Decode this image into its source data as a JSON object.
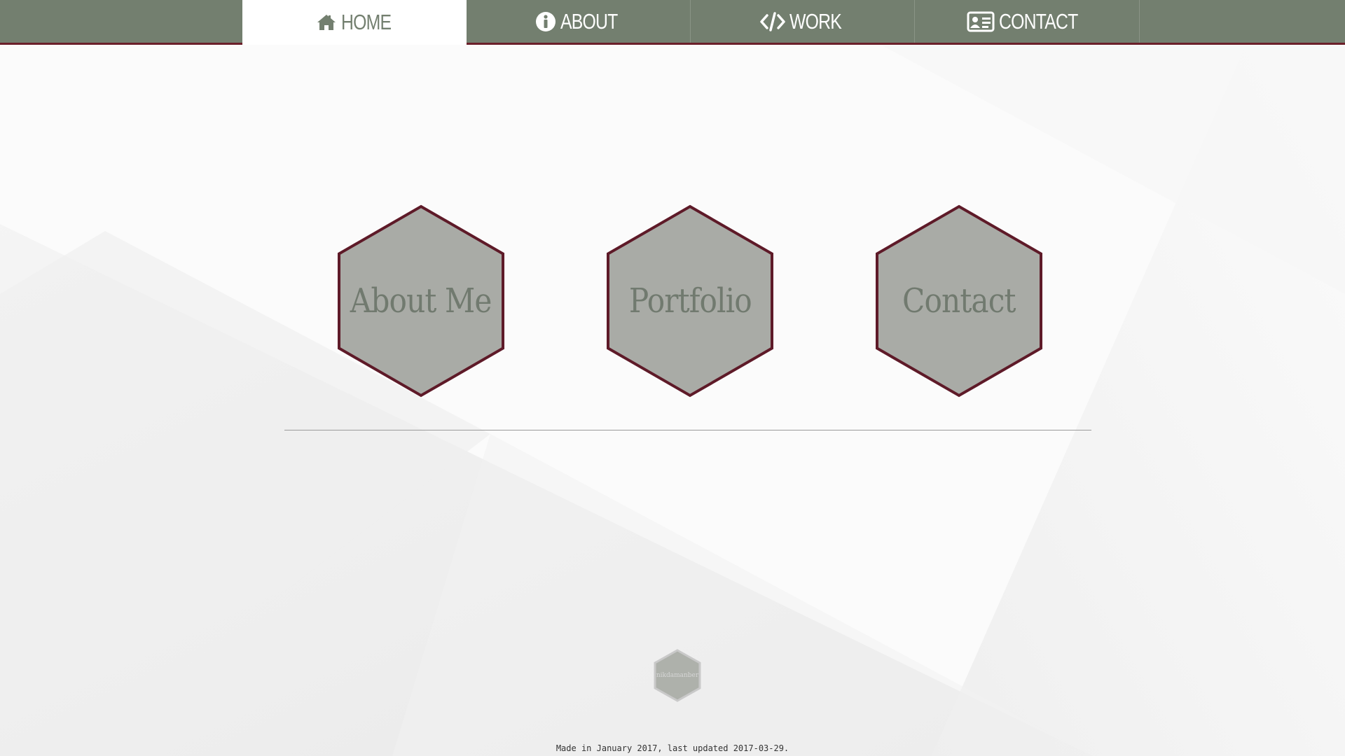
{
  "nav": {
    "items": [
      {
        "label": "HOME",
        "icon": "home-icon",
        "active": true
      },
      {
        "label": "ABOUT",
        "icon": "info-icon",
        "active": false
      },
      {
        "label": "WORK",
        "icon": "code-icon",
        "active": false
      },
      {
        "label": "CONTACT",
        "icon": "contact-card-icon",
        "active": false
      }
    ]
  },
  "hexes": [
    {
      "label": "About Me"
    },
    {
      "label": "Portfolio"
    },
    {
      "label": "Contact"
    }
  ],
  "footer": {
    "logo_text": "nikdamanber",
    "text": "Made in January 2017, last updated 2017-03-29."
  },
  "colors": {
    "nav_bg": "#737f6f",
    "nav_border": "#6b1f2a",
    "hex_fill": "#a9aba6",
    "hex_stroke": "#5e1a28",
    "hex_text": "#717a6f"
  }
}
